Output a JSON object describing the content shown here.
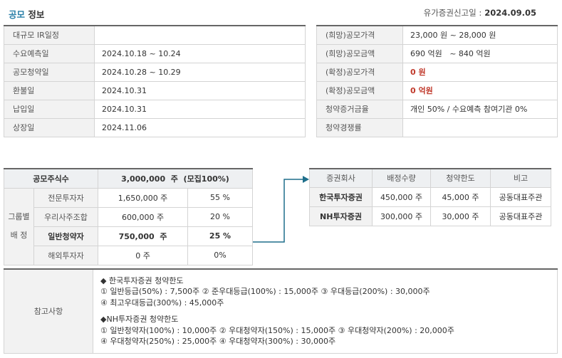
{
  "header": {
    "title_accent": "공모",
    "title_rest": "정보",
    "filing_label": "유가증권신고일 :",
    "filing_date": "2024.09.05"
  },
  "schedule": [
    {
      "label": "대규모 IR일정",
      "value": ""
    },
    {
      "label": "수요예측일",
      "value": "2024.10.18 ~ 10.24"
    },
    {
      "label": "공모청약일",
      "value": "2024.10.28 ~ 10.29"
    },
    {
      "label": "환불일",
      "value": "2024.10.31"
    },
    {
      "label": "납입일",
      "value": "2024.10.31"
    },
    {
      "label": "상장일",
      "value": "2024.11.06"
    }
  ],
  "pricing": [
    {
      "label": "(희망)공모가격",
      "value": "23,000 원 ~ 28,000 원"
    },
    {
      "label": "(희망)공모금액",
      "value": "690 억원   ~ 840 억원"
    },
    {
      "label": "(확정)공모가격",
      "value": "0 원"
    },
    {
      "label": "(확정)공모금액",
      "value": "0 억원"
    },
    {
      "label": "청약증거금율",
      "value": "개인 50% / 수요예측 참여기관 0%"
    },
    {
      "label": "청약경쟁률",
      "value": ""
    }
  ],
  "allocation": {
    "total_label": "공모주식수",
    "total_value": "3,000,000  주  (모집100%)",
    "group_label": "그룹별 배 정",
    "rows": [
      {
        "name": "전문투자자",
        "shares": "1,650,000 주",
        "pct": "55 %"
      },
      {
        "name": "우리사주조합",
        "shares": "600,000 주",
        "pct": "20 %"
      },
      {
        "name": "일반청약자",
        "shares": "750,000  주",
        "pct": "25 %"
      },
      {
        "name": "해외투자자",
        "shares": "0 주",
        "pct": "0%"
      }
    ]
  },
  "brokers": {
    "headers": [
      "증권회사",
      "배정수량",
      "청약한도",
      "비고"
    ],
    "rows": [
      {
        "name": "한국투자증권",
        "qty": "450,000 주",
        "limit": "45,000 주",
        "note": "공동대표주관"
      },
      {
        "name": "NH투자증권",
        "qty": "300,000 주",
        "limit": "30,000 주",
        "note": "공동대표주관"
      }
    ]
  },
  "notes": {
    "label": "참고사항",
    "lines": [
      "◆ 한국투자증권 청약한도",
      "① 일반등급(50%) : 7,500주 ② 준우대등급(100%) : 15,000주 ③ 우대등급(200%) : 30,000주",
      "④ 최고우대등급(300%) : 45,000주",
      "",
      "◆NH투자증권 청약한도",
      "① 일반청약자(100%) : 10,000주 ② 우대청약자(150%) : 15,000주 ③ 우대청약자(200%) : 20,000주",
      "④ 우대청약자(250%) : 25,000주 ④ 우대청약자(300%) : 30,000주"
    ]
  },
  "colors": {
    "accent": "#2a7fa8",
    "highlight_red": "#c0392b",
    "arrow": "#1f6f8b"
  }
}
